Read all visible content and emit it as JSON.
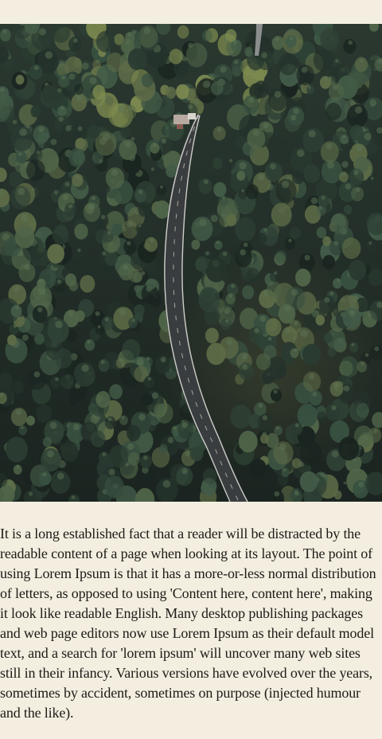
{
  "image": {
    "subject": "aerial-forest-road"
  },
  "article": {
    "paragraph": "It is a long established fact that a reader will be distracted by the readable content of a page when looking at its layout. The point of using Lorem Ipsum is that it has a more-or-less normal distribution of letters, as opposed to using 'Content here, content here', making it look like readable English. Many desktop publishing packages and web page editors now use Lorem Ipsum as their default model text, and a search for 'lorem ipsum' will uncover many web sites still in their infancy. Various versions have evolved over the years, sometimes by accident, sometimes on purpose (injected humour and the like)."
  },
  "colors": {
    "page_background": "#f3eee0",
    "text": "#1e1a16",
    "forest_dark": "#1c2621",
    "forest_mid": "#2c3a31",
    "road": "#3a3d3f",
    "road_line": "#e8e6df"
  }
}
